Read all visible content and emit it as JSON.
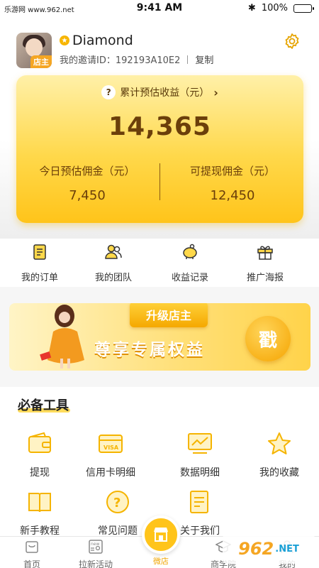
{
  "status_bar": {
    "site": "乐游网 www.962.net",
    "time": "9:41 AM",
    "battery": "100%"
  },
  "profile": {
    "avatar_tag": "店主",
    "name": "Diamond",
    "invite_label": "我的邀请ID：192193A10E2",
    "copy": "复制"
  },
  "earnings": {
    "title": "累计预估收益（元）",
    "total": "14,365",
    "today_label": "今日预估佣金（元）",
    "today_value": "7,450",
    "withdraw_label": "可提现佣金（元）",
    "withdraw_value": "12,450"
  },
  "quick_actions": [
    {
      "label": "我的订单",
      "icon": "order-icon"
    },
    {
      "label": "我的团队",
      "icon": "team-icon"
    },
    {
      "label": "收益记录",
      "icon": "piggy-bank-icon"
    },
    {
      "label": "推广海报",
      "icon": "gift-icon"
    }
  ],
  "banner": {
    "ribbon": "升级店主",
    "slogan": "尊享专属权益",
    "stamp": "戳"
  },
  "tools": {
    "title": "必备工具",
    "items": [
      {
        "label": "提现",
        "icon": "wallet-icon"
      },
      {
        "label": "信用卡明细",
        "icon": "visa-card-icon"
      },
      {
        "label": "数据明细",
        "icon": "line-chart-icon"
      },
      {
        "label": "我的收藏",
        "icon": "star-icon"
      },
      {
        "label": "新手教程",
        "icon": "book-icon"
      },
      {
        "label": "常见问题",
        "icon": "question-icon"
      },
      {
        "label": "关于我们",
        "icon": "document-icon"
      }
    ]
  },
  "tabbar": {
    "home": "首页",
    "activity": "拉新活动",
    "store": "微店",
    "mall": "商学院",
    "mine": "我的"
  },
  "watermark": {
    "brand": "962",
    "net": ".NET"
  },
  "colors": {
    "accent": "#ffc41a",
    "accent_dark": "#f5a623",
    "text_brown": "#6b3f0a"
  }
}
